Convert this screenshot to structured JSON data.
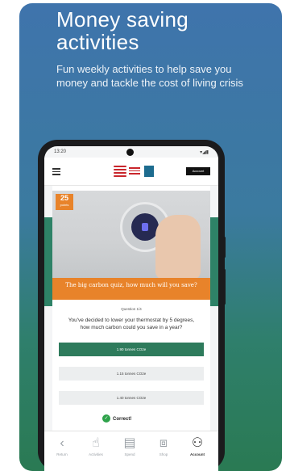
{
  "promo": {
    "headline": "Money saving activities",
    "subline": "Fun weekly activities to help save you money and tackle the cost of living crisis"
  },
  "device": {
    "status_time": "13:20",
    "status_signal": "▾◢▮",
    "menu_icon": "menu-icon",
    "account_button": "Account"
  },
  "activity": {
    "badge_number": "25",
    "badge_unit": "points",
    "title": "The big carbon quiz, how much will you save?",
    "question_counter": "Question 1/4",
    "question_text": "You've decided to lower your thermostat by 5 degrees, how much carbon could you save in a year?",
    "options": [
      {
        "label": "1.90 tonnes CO2e",
        "selected": true
      },
      {
        "label": "1.15 tonnes CO2e",
        "selected": false
      },
      {
        "label": "1.40 tonnes CO2e",
        "selected": false
      }
    ],
    "result_icon": "check-circle-icon",
    "result_text": "Correct!"
  },
  "bottom_nav": [
    {
      "icon": "back-arrow-icon",
      "glyph": "‹",
      "label": "Return"
    },
    {
      "icon": "hand-icon",
      "glyph": "☝",
      "label": "Activities"
    },
    {
      "icon": "receipt-icon",
      "glyph": "▤",
      "label": "Spend"
    },
    {
      "icon": "gift-icon",
      "glyph": "⧈",
      "label": "Shop"
    },
    {
      "icon": "people-icon",
      "glyph": "⚇",
      "label": "Account"
    }
  ],
  "colors": {
    "card_top": "#3f74ac",
    "card_bottom": "#2a7a53",
    "accent_orange": "#e8832a",
    "selected_green": "#2e7b5c",
    "brand_red": "#c9262c"
  }
}
